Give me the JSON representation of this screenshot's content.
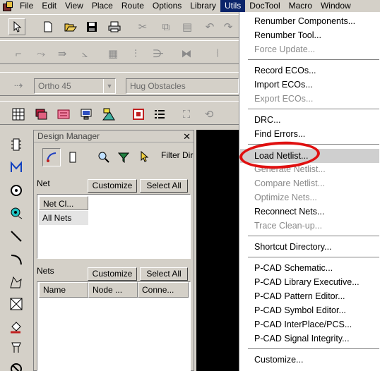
{
  "menubar": {
    "items": [
      "File",
      "Edit",
      "View",
      "Place",
      "Route",
      "Options",
      "Library",
      "Utils",
      "DocTool",
      "Macro",
      "Window"
    ]
  },
  "toolbar": {
    "route_mode": "Ortho 45",
    "obstacle_mode": "Hug Obstacles"
  },
  "design_manager": {
    "title": "Design Manager",
    "filter_label": "Filter Dir",
    "net_pane_label": "Net",
    "net_pane_customize": "Customize",
    "net_pane_select_all": "Select All",
    "net_classes": [
      "Net Cl...",
      "All Nets"
    ],
    "nets_pane_label": "Nets",
    "nets_customize": "Customize",
    "nets_select_all": "Select All",
    "nets_columns": [
      "Name",
      "Node ...",
      "Conne..."
    ]
  },
  "utils_menu": {
    "items": [
      {
        "label": "Renumber Components...",
        "enabled": true
      },
      {
        "label": "Renumber Tool...",
        "enabled": true
      },
      {
        "label": "Force Update...",
        "enabled": false
      },
      {
        "label": "Record ECOs...",
        "enabled": true
      },
      {
        "label": "Import ECOs...",
        "enabled": true
      },
      {
        "label": "Export ECOs...",
        "enabled": false
      },
      {
        "label": "DRC...",
        "enabled": true
      },
      {
        "label": "Find Errors...",
        "enabled": true
      },
      {
        "label": "Load Netlist...",
        "enabled": true
      },
      {
        "label": "Generate Netlist...",
        "enabled": false
      },
      {
        "label": "Compare Netlist...",
        "enabled": false
      },
      {
        "label": "Optimize Nets...",
        "enabled": false
      },
      {
        "label": "Reconnect Nets...",
        "enabled": true
      },
      {
        "label": "Trace Clean-up...",
        "enabled": false
      },
      {
        "label": "Shortcut Directory...",
        "enabled": true
      },
      {
        "label": "P-CAD Schematic...",
        "enabled": true
      },
      {
        "label": "P-CAD Library Executive...",
        "enabled": true
      },
      {
        "label": "P-CAD Pattern Editor...",
        "enabled": true
      },
      {
        "label": "P-CAD Symbol Editor...",
        "enabled": true
      },
      {
        "label": "P-CAD InterPlace/PCS...",
        "enabled": true
      },
      {
        "label": "P-CAD Signal Integrity...",
        "enabled": true
      },
      {
        "label": "Customize...",
        "enabled": true
      }
    ]
  },
  "colors": {
    "menu_highlight": "#0a246a",
    "annotation_circle": "#e01010",
    "canvas": "#000000"
  }
}
